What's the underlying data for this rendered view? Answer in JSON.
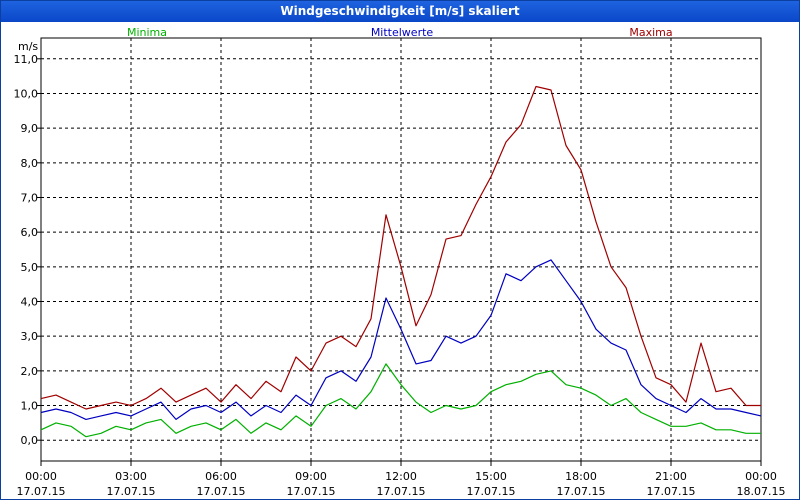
{
  "window": {
    "title": "Windgeschwindigkeit [m/s] skaliert"
  },
  "chart_data": {
    "type": "line",
    "title": "Windgeschwindigkeit [m/s] skaliert",
    "ylabel": "m/s",
    "xlabel": "",
    "ylim": [
      -0.6,
      11.6
    ],
    "grid": true,
    "legend_placement": "top",
    "yticks": [
      "0,0",
      "1,0",
      "2,0",
      "3,0",
      "4,0",
      "5,0",
      "6,0",
      "7,0",
      "8,0",
      "9,0",
      "10,0",
      "11,0"
    ],
    "xticks": [
      {
        "time": "00:00",
        "date": "17.07.15"
      },
      {
        "time": "03:00",
        "date": "17.07.15"
      },
      {
        "time": "06:00",
        "date": "17.07.15"
      },
      {
        "time": "09:00",
        "date": "17.07.15"
      },
      {
        "time": "12:00",
        "date": "17.07.15"
      },
      {
        "time": "15:00",
        "date": "17.07.15"
      },
      {
        "time": "18:00",
        "date": "17.07.15"
      },
      {
        "time": "21:00",
        "date": "17.07.15"
      },
      {
        "time": "00:00",
        "date": "18.07.15"
      }
    ],
    "x_hours": [
      0,
      0.5,
      1,
      1.5,
      2,
      2.5,
      3,
      3.5,
      4,
      4.5,
      5,
      5.5,
      6,
      6.5,
      7,
      7.5,
      8,
      8.5,
      9,
      9.5,
      10,
      10.5,
      11,
      11.5,
      12,
      12.5,
      13,
      13.5,
      14,
      14.5,
      15,
      15.5,
      16,
      16.5,
      17,
      17.5,
      18,
      18.5,
      19,
      19.5,
      20,
      20.5,
      21,
      21.5,
      22,
      22.5,
      23,
      23.5,
      24
    ],
    "series": [
      {
        "name": "Minima",
        "color": "#00b000",
        "values": [
          0.3,
          0.5,
          0.4,
          0.1,
          0.2,
          0.4,
          0.3,
          0.5,
          0.6,
          0.2,
          0.4,
          0.5,
          0.3,
          0.6,
          0.2,
          0.5,
          0.3,
          0.7,
          0.4,
          1.0,
          1.2,
          0.9,
          1.4,
          2.2,
          1.6,
          1.1,
          0.8,
          1.0,
          0.9,
          1.0,
          1.4,
          1.6,
          1.7,
          1.9,
          2.0,
          1.6,
          1.5,
          1.3,
          1.0,
          1.2,
          0.8,
          0.6,
          0.4,
          0.4,
          0.5,
          0.3,
          0.3,
          0.2,
          0.2
        ]
      },
      {
        "name": "Mittelwerte",
        "color": "#0000c0",
        "values": [
          0.8,
          0.9,
          0.8,
          0.6,
          0.7,
          0.8,
          0.7,
          0.9,
          1.1,
          0.6,
          0.9,
          1.0,
          0.8,
          1.1,
          0.7,
          1.0,
          0.8,
          1.3,
          1.0,
          1.8,
          2.0,
          1.7,
          2.4,
          4.1,
          3.2,
          2.2,
          2.3,
          3.0,
          2.8,
          3.0,
          3.6,
          4.8,
          4.6,
          5.0,
          5.2,
          4.6,
          4.0,
          3.2,
          2.8,
          2.6,
          1.6,
          1.2,
          1.0,
          0.8,
          1.2,
          0.9,
          0.9,
          0.8,
          0.7
        ]
      },
      {
        "name": "Maxima",
        "color": "#a00000",
        "values": [
          1.2,
          1.3,
          1.1,
          0.9,
          1.0,
          1.1,
          1.0,
          1.2,
          1.5,
          1.1,
          1.3,
          1.5,
          1.1,
          1.6,
          1.2,
          1.7,
          1.4,
          2.4,
          2.0,
          2.8,
          3.0,
          2.7,
          3.5,
          6.5,
          5.0,
          3.3,
          4.2,
          5.8,
          5.9,
          6.8,
          7.6,
          8.6,
          9.1,
          10.2,
          10.1,
          8.5,
          7.8,
          6.3,
          5.0,
          4.4,
          3.0,
          1.8,
          1.6,
          1.1,
          2.8,
          1.4,
          1.5,
          1.0,
          1.0
        ]
      }
    ]
  }
}
